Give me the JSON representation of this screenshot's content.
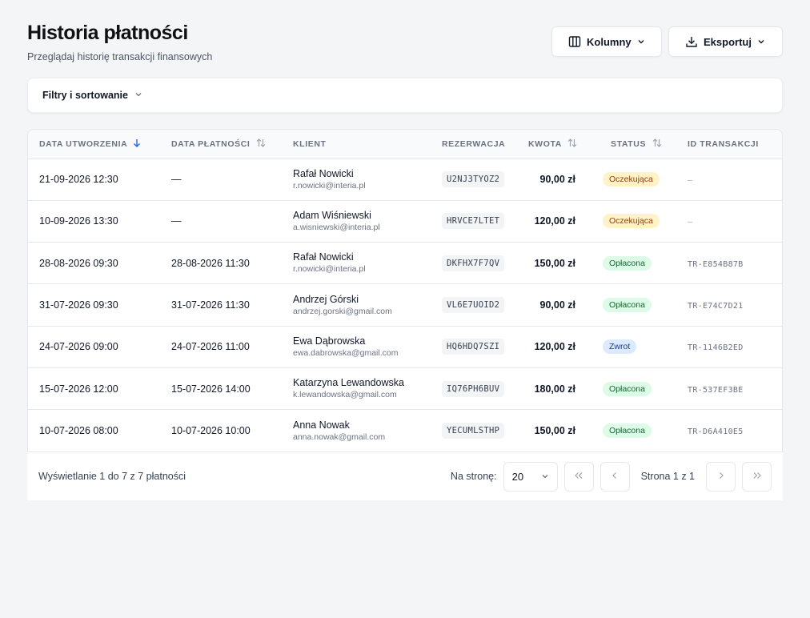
{
  "header": {
    "title": "Historia płatności",
    "subtitle": "Przeglądaj historię transakcji finansowych",
    "columns_label": "Kolumny",
    "export_label": "Eksportuj"
  },
  "filters": {
    "toggle_label": "Filtry i sortowanie"
  },
  "table": {
    "columns": {
      "created": "DATA UTWORZENIA",
      "paid": "DATA PŁATNOŚCI",
      "client": "KLIENT",
      "reservation": "REZERWACJA",
      "amount": "KWOTA",
      "status": "STATUS",
      "transaction": "ID TRANSAKCJI"
    },
    "rows": [
      {
        "created": "21-09-2026 12:30",
        "paid": "—",
        "client_name": "Rafał Nowicki",
        "client_email": "r.nowicki@interia.pl",
        "reservation": "U2NJ3TYOZ2",
        "amount": "90,00 zł",
        "status": "Oczekująca",
        "status_type": "pending",
        "transaction": "—"
      },
      {
        "created": "10-09-2026 13:30",
        "paid": "—",
        "client_name": "Adam Wiśniewski",
        "client_email": "a.wisniewski@interia.pl",
        "reservation": "HRVCE7LTET",
        "amount": "120,00 zł",
        "status": "Oczekująca",
        "status_type": "pending",
        "transaction": "—"
      },
      {
        "created": "28-08-2026 09:30",
        "paid": "28-08-2026 11:30",
        "client_name": "Rafał Nowicki",
        "client_email": "r.nowicki@interia.pl",
        "reservation": "DKFHX7F7QV",
        "amount": "150,00 zł",
        "status": "Opłacona",
        "status_type": "paid",
        "transaction": "TR-E854B87B"
      },
      {
        "created": "31-07-2026 09:30",
        "paid": "31-07-2026 11:30",
        "client_name": "Andrzej Górski",
        "client_email": "andrzej.gorski@gmail.com",
        "reservation": "VL6E7UOID2",
        "amount": "90,00 zł",
        "status": "Opłacona",
        "status_type": "paid",
        "transaction": "TR-E74C7D21"
      },
      {
        "created": "24-07-2026 09:00",
        "paid": "24-07-2026 11:00",
        "client_name": "Ewa Dąbrowska",
        "client_email": "ewa.dabrowska@gmail.com",
        "reservation": "HQ6HDQ7SZI",
        "amount": "120,00 zł",
        "status": "Zwrot",
        "status_type": "refund",
        "transaction": "TR-1146B2ED"
      },
      {
        "created": "15-07-2026 12:00",
        "paid": "15-07-2026 14:00",
        "client_name": "Katarzyna Lewandowska",
        "client_email": "k.lewandowska@gmail.com",
        "reservation": "IQ76PH6BUV",
        "amount": "180,00 zł",
        "status": "Opłacona",
        "status_type": "paid",
        "transaction": "TR-537EF3BE"
      },
      {
        "created": "10-07-2026 08:00",
        "paid": "10-07-2026 10:00",
        "client_name": "Anna Nowak",
        "client_email": "anna.nowak@gmail.com",
        "reservation": "YECUMLSTHP",
        "amount": "150,00 zł",
        "status": "Opłacona",
        "status_type": "paid",
        "transaction": "TR-D6A410E5"
      }
    ]
  },
  "footer": {
    "showing": "Wyświetlanie 1 do 7 z 7 płatności",
    "per_page_label": "Na stronę:",
    "per_page_value": "20",
    "page_info": "Strona 1 z 1"
  },
  "colors": {
    "background": "#f4f5f7",
    "sort_active": "#2563eb",
    "badge_pending": "#fef3c7",
    "badge_paid": "#dcfce7",
    "badge_refund": "#dbeafe"
  },
  "icons": {
    "columns": "columns-icon",
    "export": "download-icon",
    "chevron": "chevron-down-icon",
    "sort_desc": "arrow-down-icon",
    "sort_both": "sort-icon",
    "first": "chevrons-left-icon",
    "prev": "chevron-left-icon",
    "next": "chevron-right-icon",
    "last": "chevrons-right-icon"
  }
}
